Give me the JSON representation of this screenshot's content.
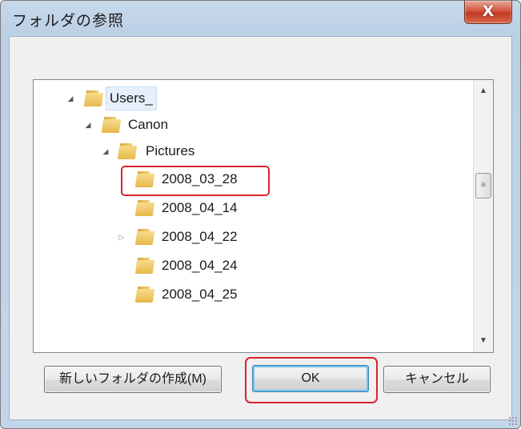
{
  "dialog": {
    "title": "フォルダの参照",
    "close_label": "X"
  },
  "tree": {
    "nodes": [
      {
        "label": "Users_",
        "level": 0,
        "expander": "expanded",
        "selected": true
      },
      {
        "label": "Canon",
        "level": 1,
        "expander": "expanded",
        "selected": false
      },
      {
        "label": "Pictures",
        "level": 2,
        "expander": "expanded",
        "selected": false
      },
      {
        "label": "2008_03_28",
        "level": 3,
        "expander": "none",
        "selected": false,
        "highlighted": true
      },
      {
        "label": "2008_04_14",
        "level": 3,
        "expander": "none",
        "selected": false
      },
      {
        "label": "2008_04_22",
        "level": 3,
        "expander": "collapsed",
        "selected": false
      },
      {
        "label": "2008_04_24",
        "level": 3,
        "expander": "none",
        "selected": false
      },
      {
        "label": "2008_04_25",
        "level": 3,
        "expander": "none",
        "selected": false
      }
    ],
    "scroll_up_icon": "▲",
    "scroll_down_icon": "▼",
    "thumb_grip_icon": "≡"
  },
  "buttons": {
    "new_folder_label": "新しいフォルダの作成(M)",
    "ok_label": "OK",
    "cancel_label": "キャンセル"
  },
  "colors": {
    "highlight_red": "#d9232d",
    "folder_yellow": "#f0c85a",
    "close_red": "#c13a25"
  }
}
